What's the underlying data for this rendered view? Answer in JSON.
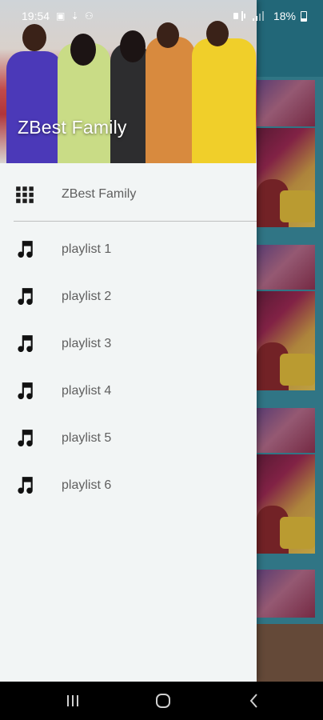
{
  "status_bar": {
    "time": "19:54",
    "left_icons": "▣ ⇣ ⚇",
    "battery": "18%"
  },
  "drawer": {
    "header_title": "ZBest Family",
    "items": [
      {
        "label": "ZBest Family",
        "icon": "grid-icon"
      },
      {
        "label": "playlist 1",
        "icon": "music-note-icon"
      },
      {
        "label": "playlist 2",
        "icon": "music-note-icon"
      },
      {
        "label": "playlist 3",
        "icon": "music-note-icon"
      },
      {
        "label": "playlist 4",
        "icon": "music-note-icon"
      },
      {
        "label": "playlist 5",
        "icon": "music-note-icon"
      },
      {
        "label": "playlist 6",
        "icon": "music-note-icon"
      }
    ]
  },
  "nav_bar": {
    "recents": "recent-apps-icon",
    "home": "home-icon",
    "back": "back-icon"
  },
  "colors": {
    "app_bar": "#2a7e93",
    "drawer_bg": "#f2f5f5",
    "label_text": "#5f5f5f"
  }
}
